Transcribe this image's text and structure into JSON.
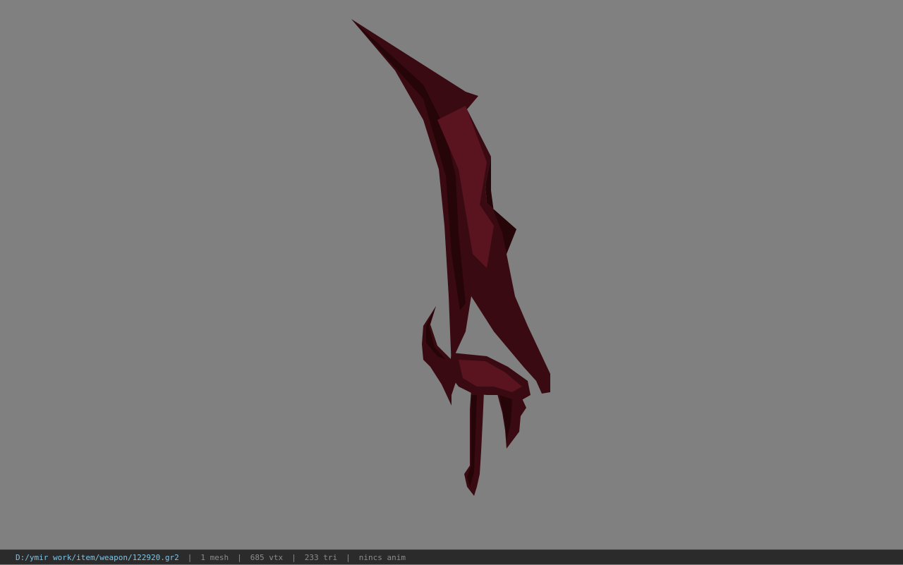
{
  "viewport": {
    "background_color": "#808080",
    "model": {
      "name": "weapon-mesh",
      "base_color": "#3a0a12",
      "highlight_color": "#5a1420",
      "shadow_color": "#260509"
    }
  },
  "status_bar": {
    "file_path": "D:/ymir work/item/weapon/122920.gr2",
    "separator": "|",
    "mesh_count": "1 mesh",
    "vertex_count": "685 vtx",
    "triangle_count": "233 tri",
    "anim_status": "nincs anim",
    "path_color": "#7fc4e6",
    "text_color": "#8c8c8c"
  }
}
